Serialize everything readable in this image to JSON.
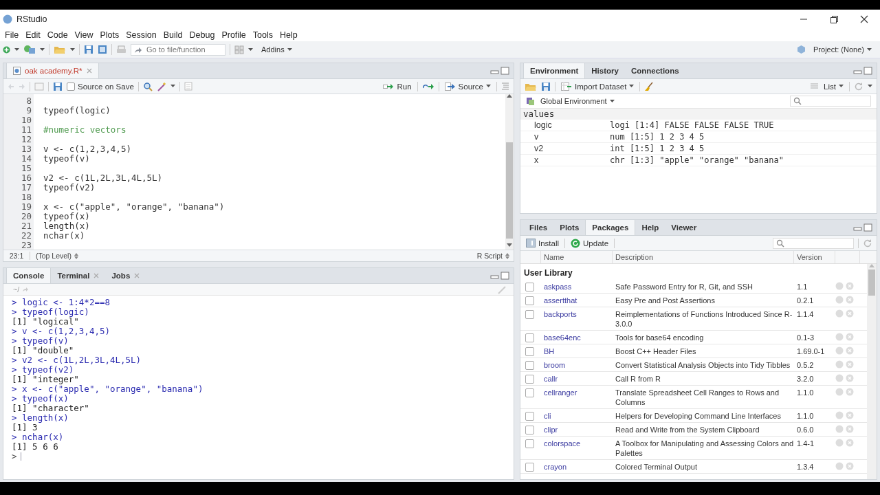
{
  "window": {
    "title": "RStudio"
  },
  "menu": [
    "File",
    "Edit",
    "Code",
    "View",
    "Plots",
    "Session",
    "Build",
    "Debug",
    "Profile",
    "Tools",
    "Help"
  ],
  "toolbar": {
    "goto_placeholder": "Go to file/function",
    "addins": "Addins",
    "project": "Project: (None)"
  },
  "editor": {
    "tabs": [
      {
        "label": "oak academy.R*",
        "selected": true,
        "modified": true,
        "closable": true
      }
    ],
    "source_on_save": {
      "label": "Source on Save",
      "checked": false
    },
    "run": "Run",
    "source": "Source",
    "lines": [
      {
        "n": "8"
      },
      {
        "n": "9",
        "kind": "code",
        "code": "typeof(logic)"
      },
      {
        "n": "10"
      },
      {
        "n": "11",
        "kind": "comment",
        "code": "#numeric vectors"
      },
      {
        "n": "12"
      },
      {
        "n": "13",
        "kind": "code",
        "code": "v <- c(1,2,3,4,5)"
      },
      {
        "n": "14",
        "kind": "code",
        "code": "typeof(v)"
      },
      {
        "n": "15"
      },
      {
        "n": "16",
        "kind": "code",
        "code": "v2 <- c(1L,2L,3L,4L,5L)"
      },
      {
        "n": "17",
        "kind": "code",
        "code": "typeof(v2)"
      },
      {
        "n": "18"
      },
      {
        "n": "19",
        "kind": "code",
        "code": "x <- c(\"apple\", \"orange\", \"banana\")"
      },
      {
        "n": "20",
        "kind": "code",
        "code": "typeof(x)"
      },
      {
        "n": "21",
        "kind": "code",
        "code": "length(x)"
      },
      {
        "n": "22",
        "kind": "code",
        "code": "nchar(x)"
      },
      {
        "n": "23"
      }
    ],
    "status": {
      "position": "23:1",
      "scope": "(Top Level)",
      "filetype": "R Script"
    }
  },
  "console": {
    "tabs": [
      {
        "label": "Console",
        "selected": true,
        "closable": false
      },
      {
        "label": "Terminal",
        "selected": false,
        "closable": true
      },
      {
        "label": "Jobs",
        "selected": false,
        "closable": true
      }
    ],
    "path": "~/",
    "lines": [
      {
        "kind": "input",
        "text": "> logic <- 1:4*2==8"
      },
      {
        "kind": "input",
        "text": "> typeof(logic)"
      },
      {
        "kind": "output",
        "text": "[1] \"logical\""
      },
      {
        "kind": "input",
        "text": "> v <- c(1,2,3,4,5)"
      },
      {
        "kind": "input",
        "text": "> typeof(v)"
      },
      {
        "kind": "output",
        "text": "[1] \"double\""
      },
      {
        "kind": "input",
        "text": "> v2 <- c(1L,2L,3L,4L,5L)"
      },
      {
        "kind": "input",
        "text": "> typeof(v2)"
      },
      {
        "kind": "output",
        "text": "[1] \"integer\""
      },
      {
        "kind": "input",
        "text": "> x <- c(\"apple\", \"orange\", \"banana\")"
      },
      {
        "kind": "input",
        "text": "> typeof(x)"
      },
      {
        "kind": "output",
        "text": "[1] \"character\""
      },
      {
        "kind": "input",
        "text": "> length(x)"
      },
      {
        "kind": "output",
        "text": "[1] 3"
      },
      {
        "kind": "input",
        "text": "> nchar(x)"
      },
      {
        "kind": "output",
        "text": "[1] 5 6 6"
      },
      {
        "kind": "prompt",
        "text": ">"
      }
    ]
  },
  "environment": {
    "tabs": [
      {
        "label": "Environment",
        "selected": true
      },
      {
        "label": "History",
        "selected": false
      },
      {
        "label": "Connections",
        "selected": false
      }
    ],
    "import": "Import Dataset",
    "view": "List",
    "scope": "Global Environment",
    "section": "values",
    "rows": [
      {
        "name": "logic",
        "value": "logi [1:4] FALSE FALSE FALSE TRUE"
      },
      {
        "name": "v",
        "value": "num [1:5] 1 2 3 4 5"
      },
      {
        "name": "v2",
        "value": "int [1:5] 1 2 3 4 5"
      },
      {
        "name": "x",
        "value": "chr [1:3] \"apple\" \"orange\" \"banana\""
      }
    ]
  },
  "packages": {
    "tabs": [
      {
        "label": "Files",
        "selected": false
      },
      {
        "label": "Plots",
        "selected": false
      },
      {
        "label": "Packages",
        "selected": true
      },
      {
        "label": "Help",
        "selected": false
      },
      {
        "label": "Viewer",
        "selected": false
      }
    ],
    "install": "Install",
    "update": "Update",
    "columns": [
      "Name",
      "Description",
      "Version"
    ],
    "library": "User Library",
    "rows": [
      {
        "name": "askpass",
        "description": "Safe Password Entry for R, Git, and SSH",
        "version": "1.1",
        "checked": false
      },
      {
        "name": "assertthat",
        "description": "Easy Pre and Post Assertions",
        "version": "0.2.1",
        "checked": false
      },
      {
        "name": "backports",
        "description": "Reimplementations of Functions Introduced Since R-3.0.0",
        "version": "1.1.4",
        "checked": false
      },
      {
        "name": "base64enc",
        "description": "Tools for base64 encoding",
        "version": "0.1-3",
        "checked": false
      },
      {
        "name": "BH",
        "description": "Boost C++ Header Files",
        "version": "1.69.0-1",
        "checked": false
      },
      {
        "name": "broom",
        "description": "Convert Statistical Analysis Objects into Tidy Tibbles",
        "version": "0.5.2",
        "checked": false
      },
      {
        "name": "callr",
        "description": "Call R from R",
        "version": "3.2.0",
        "checked": false
      },
      {
        "name": "cellranger",
        "description": "Translate Spreadsheet Cell Ranges to Rows and Columns",
        "version": "1.1.0",
        "checked": false
      },
      {
        "name": "cli",
        "description": "Helpers for Developing Command Line Interfaces",
        "version": "1.1.0",
        "checked": false
      },
      {
        "name": "clipr",
        "description": "Read and Write from the System Clipboard",
        "version": "0.6.0",
        "checked": false
      },
      {
        "name": "colorspace",
        "description": "A Toolbox for Manipulating and Assessing Colors and Palettes",
        "version": "1.4-1",
        "checked": false
      },
      {
        "name": "crayon",
        "description": "Colored Terminal Output",
        "version": "1.3.4",
        "checked": false
      }
    ]
  }
}
